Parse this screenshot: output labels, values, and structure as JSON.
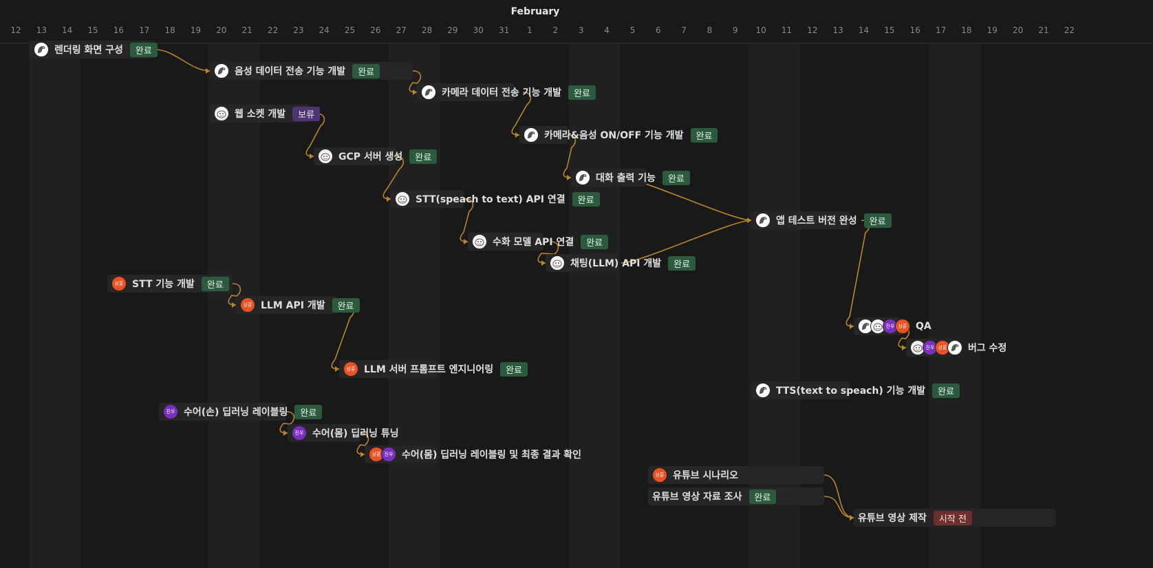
{
  "month": "February",
  "days": [
    "12",
    "13",
    "14",
    "15",
    "16",
    "17",
    "18",
    "19",
    "20",
    "21",
    "22",
    "23",
    "24",
    "25",
    "26",
    "27",
    "28",
    "29",
    "30",
    "31",
    "1",
    "2",
    "3",
    "4",
    "5",
    "6",
    "7",
    "8",
    "9",
    "10",
    "11",
    "12",
    "13",
    "14",
    "15",
    "16",
    "17",
    "18",
    "19",
    "20",
    "21",
    "22"
  ],
  "colors": {
    "link": "#b8862b",
    "done": "#2b5a3d",
    "hold": "#4c3570",
    "todo": "#6e2f2f",
    "avatar_s": "#ea5123",
    "avatar_j": "#7b2fbf"
  },
  "statuses": {
    "done": "완료",
    "hold": "보류",
    "todo": "시작 전"
  },
  "avatars": {
    "s": "상훈",
    "j": "진우",
    "g": "ghost-avatar-icon"
  },
  "tasks": [
    {
      "name": "렌더링 화면 구성",
      "status": "done",
      "avatars": [
        "ga"
      ]
    },
    {
      "name": "음성 데이터 전송 기능 개발",
      "status": "done",
      "avatars": [
        "ga"
      ]
    },
    {
      "name": "카메라 데이터 전송 기능 개발",
      "status": "done",
      "avatars": [
        "ga"
      ]
    },
    {
      "name": "웹 소켓 개발",
      "status": "hold",
      "avatars": [
        "gb"
      ]
    },
    {
      "name": "카메라&음성 ON/OFF 기능 개발",
      "status": "done",
      "avatars": [
        "ga"
      ]
    },
    {
      "name": "GCP 서버 생성",
      "status": "done",
      "avatars": [
        "gb"
      ]
    },
    {
      "name": "대화 출력 기능",
      "status": "done",
      "avatars": [
        "ga"
      ]
    },
    {
      "name": "STT(speach to text) API 연결",
      "status": "done",
      "avatars": [
        "gb"
      ]
    },
    {
      "name": "앱 테스트 버전 완성",
      "status": "done",
      "avatars": [
        "ga"
      ]
    },
    {
      "name": "수화 모델 API 연결",
      "status": "done",
      "avatars": [
        "gb"
      ]
    },
    {
      "name": "채팅(LLM) API 개발",
      "status": "done",
      "avatars": [
        "gb"
      ]
    },
    {
      "name": "STT 기능 개발",
      "status": "done",
      "avatars": [
        "s"
      ]
    },
    {
      "name": "LLM API 개발",
      "status": "done",
      "avatars": [
        "s"
      ]
    },
    {
      "name": "QA",
      "status": "",
      "avatars": [
        "ga",
        "gb",
        "j",
        "s"
      ]
    },
    {
      "name": "버그 수정",
      "status": "",
      "avatars": [
        "gb",
        "j",
        "s",
        "ga"
      ]
    },
    {
      "name": "LLM 서버 프롬프트 엔지니어링",
      "status": "done",
      "avatars": [
        "s"
      ]
    },
    {
      "name": "TTS(text to speach) 기능 개발",
      "status": "done",
      "avatars": [
        "ga"
      ]
    },
    {
      "name": "수어(손) 딥러닝 레이블링",
      "status": "done",
      "avatars": [
        "j"
      ]
    },
    {
      "name": "수어(몸) 딥러닝 튜닝",
      "status": "",
      "avatars": [
        "j"
      ]
    },
    {
      "name": "수어(몸) 딥러닝 레이블링 및 최종 결과 확인",
      "status": "",
      "avatars": [
        "s",
        "j"
      ]
    },
    {
      "name": "유튜브 시나리오",
      "status": "",
      "avatars": [
        "s"
      ]
    },
    {
      "name": "유튜브 영상 자료 조사",
      "status": "done",
      "avatars": []
    },
    {
      "name": "유튜브 영상 제작",
      "status": "todo",
      "avatars": []
    }
  ]
}
